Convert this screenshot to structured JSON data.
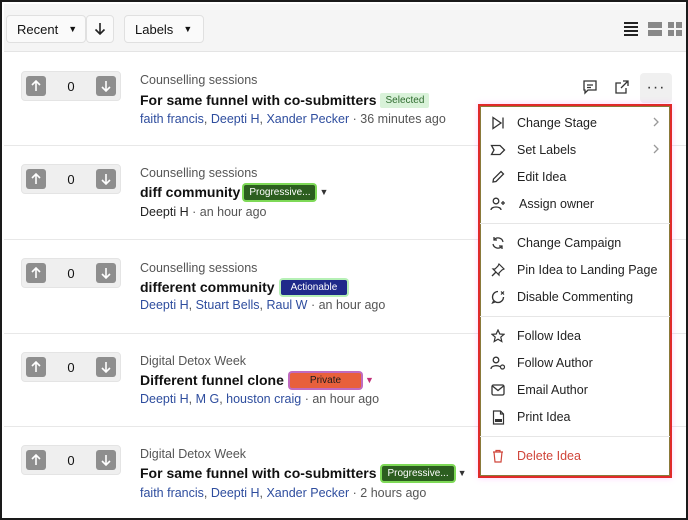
{
  "toolbar": {
    "sort_label": "Recent",
    "labels_label": "Labels"
  },
  "ideas": [
    {
      "campaign": "Counselling sessions",
      "title": "For same funnel with co-submitters",
      "badge": "Selected",
      "votes": "0",
      "people": [
        "faith francis",
        "Deepti H",
        "Xander Pecker"
      ],
      "time": "36 minutes ago"
    },
    {
      "campaign": "Counselling sessions",
      "title": "diff community",
      "badge": "Progressive...",
      "votes": "0",
      "people": [
        "Deepti H"
      ],
      "time": "an hour ago"
    },
    {
      "campaign": "Counselling sessions",
      "title": "different community",
      "badge": "Actionable",
      "votes": "0",
      "people": [
        "Deepti H",
        "Stuart Bells",
        "Raul W"
      ],
      "time": "an hour ago"
    },
    {
      "campaign": "Digital Detox Week",
      "title": "Different funnel clone",
      "badge": "Private",
      "votes": "0",
      "people": [
        "Deepti H",
        "M G",
        "houston craig"
      ],
      "time": "an hour ago"
    },
    {
      "campaign": "Digital Detox Week",
      "title": "For same funnel with co-submitters",
      "badge": "Progressive...",
      "votes": "0",
      "people": [
        "faith francis",
        "Deepti H",
        "Xander Pecker"
      ],
      "time": "2 hours ago"
    }
  ],
  "meta_separator": "·",
  "more_label": "···",
  "menu": {
    "change_stage": "Change Stage",
    "set_labels": "Set Labels",
    "edit_idea": "Edit Idea",
    "assign_owner": "Assign owner",
    "change_campaign": "Change Campaign",
    "pin_idea": "Pin Idea to Landing Page",
    "disable_commenting": "Disable Commenting",
    "follow_idea": "Follow Idea",
    "follow_author": "Follow Author",
    "email_author": "Email Author",
    "print_idea": "Print Idea",
    "delete_idea": "Delete Idea"
  },
  "colors": {
    "accent_link": "#2e4d9e",
    "danger": "#d0453a",
    "menu_border": "#e02a2a"
  }
}
